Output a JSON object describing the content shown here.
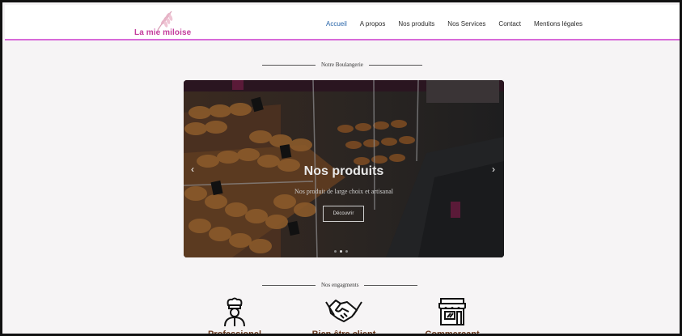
{
  "brand": {
    "name": "La mie miloise",
    "accent": "#d86ad9"
  },
  "nav": {
    "items": [
      {
        "label": "Accueil",
        "active": true
      },
      {
        "label": "A propos",
        "active": false
      },
      {
        "label": "Nos produits",
        "active": false
      },
      {
        "label": "Nos Services",
        "active": false
      },
      {
        "label": "Contact",
        "active": false
      },
      {
        "label": "Mentions légales",
        "active": false
      }
    ]
  },
  "bakery_section": {
    "title": "Notre Boulangerie"
  },
  "carousel": {
    "title": "Nos produits",
    "subtitle": "Nos produit de large choix et artisanal",
    "button_label": "Découvrir",
    "prev_icon": "chevron-left-icon",
    "next_icon": "chevron-right-icon",
    "active_slide": 2,
    "slide_count": 3
  },
  "engagements_section": {
    "title": "Nos engagments"
  },
  "engagements": [
    {
      "icon": "chef-icon",
      "label": "Professionel"
    },
    {
      "icon": "handshake-icon",
      "label": "Bien être client"
    },
    {
      "icon": "shop-icon",
      "label": "Commercant"
    }
  ]
}
